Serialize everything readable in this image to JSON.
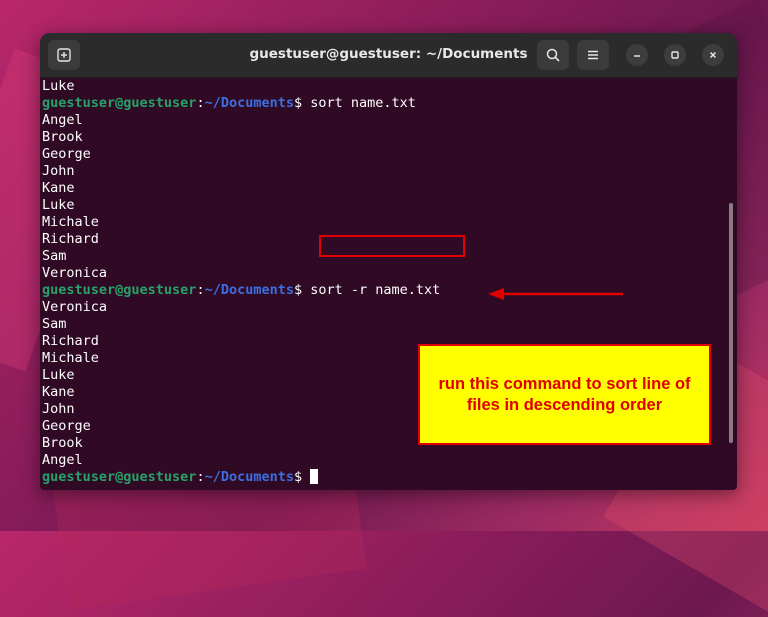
{
  "window": {
    "title": "guestuser@guestuser: ~/Documents"
  },
  "icons": {
    "new_tab": "new-tab-icon",
    "search": "search-icon",
    "menu": "hamburger-menu-icon",
    "minimize": "minimize-icon",
    "maximize": "maximize-icon",
    "close": "close-icon"
  },
  "prompt": {
    "user_host": "guestuser@guestuser",
    "colon": ":",
    "path": "~/Documents",
    "symbol": "$"
  },
  "lines": [
    {
      "type": "output",
      "text": "Luke"
    },
    {
      "type": "prompt",
      "command": " sort name.txt"
    },
    {
      "type": "output",
      "text": "Angel"
    },
    {
      "type": "output",
      "text": "Brook"
    },
    {
      "type": "output",
      "text": "George"
    },
    {
      "type": "output",
      "text": "John"
    },
    {
      "type": "output",
      "text": "Kane"
    },
    {
      "type": "output",
      "text": "Luke"
    },
    {
      "type": "output",
      "text": "Michale"
    },
    {
      "type": "output",
      "text": "Richard"
    },
    {
      "type": "output",
      "text": "Sam"
    },
    {
      "type": "output",
      "text": "Veronica"
    },
    {
      "type": "prompt",
      "command": " sort -r name.txt"
    },
    {
      "type": "output",
      "text": "Veronica"
    },
    {
      "type": "output",
      "text": "Sam"
    },
    {
      "type": "output",
      "text": "Richard"
    },
    {
      "type": "output",
      "text": "Michale"
    },
    {
      "type": "output",
      "text": "Luke"
    },
    {
      "type": "output",
      "text": "Kane"
    },
    {
      "type": "output",
      "text": "John"
    },
    {
      "type": "output",
      "text": "George"
    },
    {
      "type": "output",
      "text": "Brook"
    },
    {
      "type": "output",
      "text": "Angel"
    },
    {
      "type": "prompt",
      "command": " "
    }
  ],
  "annotation": {
    "callout_text": "run this command to sort line of files in descending order",
    "accent_color": "#e00000",
    "callout_bg": "#ffff00"
  },
  "colors": {
    "terminal_bg": "#300a24",
    "prompt_user": "#26a269",
    "prompt_path": "#3c6ee0",
    "titlebar_bg": "#2b2b2b"
  }
}
